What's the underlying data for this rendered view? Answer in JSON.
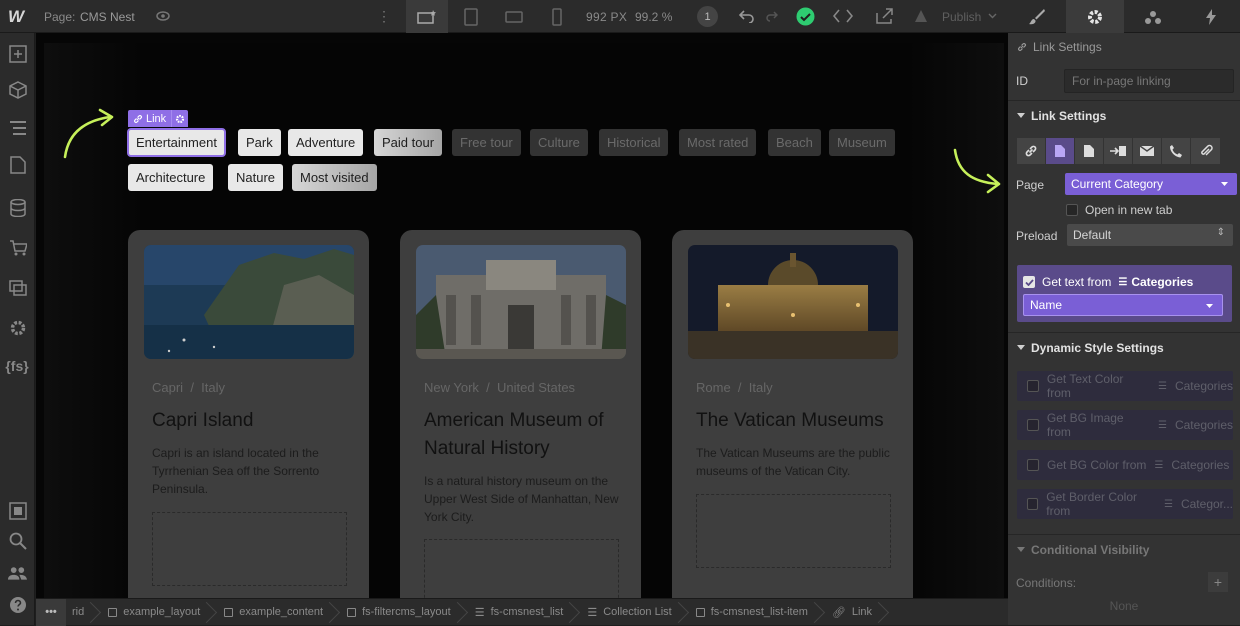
{
  "topbar": {
    "logo": "W",
    "page_prefix": "Page:",
    "page_name": "CMS Nest",
    "width_value": "992 PX",
    "zoom_value": "99.2 %",
    "history_count": "1",
    "publish_label": "Publish"
  },
  "canvas": {
    "link_badge": "Link",
    "tags": [
      {
        "label": "Entertainment"
      },
      {
        "label": "Park"
      },
      {
        "label": "Adventure"
      },
      {
        "label": "Paid tour"
      },
      {
        "label": "Free tour"
      },
      {
        "label": "Culture"
      },
      {
        "label": "Historical"
      },
      {
        "label": "Most rated"
      },
      {
        "label": "Beach"
      },
      {
        "label": "Museum"
      },
      {
        "label": "Architecture"
      },
      {
        "label": "Nature"
      },
      {
        "label": "Most visited"
      }
    ],
    "cards": [
      {
        "city": "Capri",
        "country": "Italy",
        "title": "Capri Island",
        "description": "Capri is an island located in the Tyrrhenian Sea off the Sorrento Peninsula."
      },
      {
        "city": "New York",
        "country": "United States",
        "title": "American Museum of Natural History",
        "description": "Is a natural history museum on the Upper West Side of Manhattan, New York City."
      },
      {
        "city": "Rome",
        "country": "Italy",
        "title": "The Vatican Museums",
        "description": "The Vatican Museums are the public museums of the Vatican City."
      }
    ],
    "location_separator": "/"
  },
  "breadcrumb": {
    "more": "•••",
    "items": [
      "rid",
      "example_layout",
      "example_content",
      "fs-filtercms_layout",
      "fs-cmsnest_list",
      "Collection List",
      "fs-cmsnest_list-item",
      "Link"
    ]
  },
  "panel": {
    "title": "Link Settings",
    "id_label": "ID",
    "id_placeholder": "For in-page linking",
    "section_link": "Link Settings",
    "page_label": "Page",
    "page_value": "Current Category",
    "new_tab_label": "Open in new tab",
    "preload_label": "Preload",
    "preload_value": "Default",
    "get_text_label": "Get text from",
    "get_text_source": "Categories",
    "name_value": "Name",
    "section_dynamic": "Dynamic Style Settings",
    "dynamic_items": [
      {
        "label": "Get Text Color from",
        "source": "Categories"
      },
      {
        "label": "Get BG Image from",
        "source": "Categories"
      },
      {
        "label": "Get BG Color from",
        "source": "Categories"
      },
      {
        "label": "Get Border Color from",
        "source": "Categor..."
      }
    ],
    "section_visibility": "Conditional Visibility",
    "conditions_label": "Conditions:",
    "conditions_add": "+",
    "conditions_value": "None"
  },
  "colors": {
    "accent": "#8f6fe6",
    "arrow": "#c6f05a",
    "success": "#2ecc71"
  }
}
